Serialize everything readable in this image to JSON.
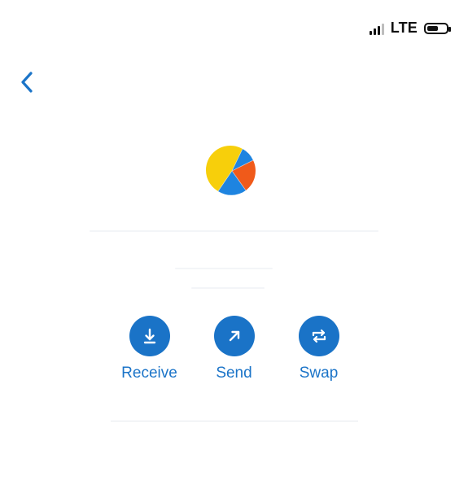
{
  "status_bar": {
    "network": "LTE",
    "signal_bars": 4,
    "signal_strength": 3,
    "battery_level": 0.55
  },
  "nav": {
    "back_icon": "chevron-left-icon"
  },
  "token": {
    "avatar_icon": "multicolor-pie-icon",
    "colors": {
      "yellow": "#f7cf0b",
      "blue": "#1e84e0",
      "orange": "#f05a1a"
    }
  },
  "actions": [
    {
      "label": "Receive",
      "icon": "download-icon"
    },
    {
      "label": "Send",
      "icon": "arrow-up-right-icon"
    },
    {
      "label": "Swap",
      "icon": "swap-arrows-icon"
    }
  ],
  "colors": {
    "accent": "#1b74c8",
    "button": "#1a73c7",
    "divider": "#e6e9ee"
  }
}
